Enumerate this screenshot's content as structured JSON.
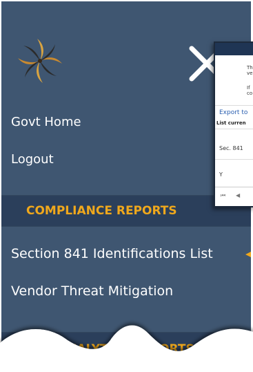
{
  "nav": {
    "items": [
      {
        "label": "Govt Home"
      },
      {
        "label": "Logout"
      }
    ]
  },
  "sections": [
    {
      "title": "COMPLIANCE REPORTS",
      "items": [
        {
          "label": "Section 841 Identifications List"
        },
        {
          "label": "Vendor Threat Mitigation"
        }
      ]
    },
    {
      "title": "ANALYTICS REPORTS"
    }
  ],
  "popup": {
    "line1": "Th",
    "line2": "ve",
    "line3": "If",
    "line4": "co",
    "export_label": "Export to",
    "list_label": "List curren",
    "cell1": "Sec. 841",
    "cell2": "Y",
    "pager_first": "⏮",
    "pager_prev": "◀"
  },
  "colors": {
    "menu_bg": "#3f5671",
    "section_bg": "#2b3f5b",
    "accent": "#f0a81c"
  }
}
